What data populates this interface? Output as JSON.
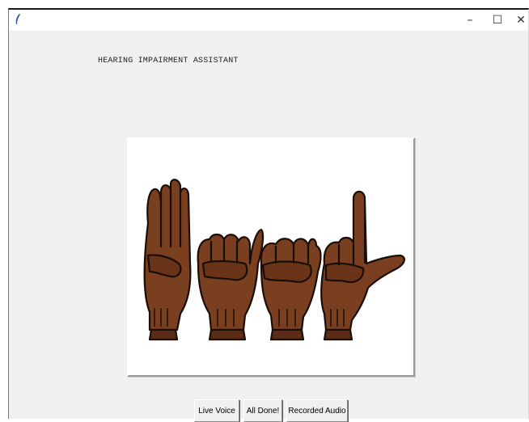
{
  "window": {
    "title": "",
    "controls": {
      "minimize": "–",
      "maximize": "☐",
      "close": "✕"
    },
    "app_icon": "feather-icon"
  },
  "main": {
    "heading": "HEARING IMPAIRMENT ASSISTANT",
    "image": {
      "description_icon": "sign-language-hands-icon"
    }
  },
  "buttons": {
    "live_voice": "Live Voice",
    "all_done": "All Done!",
    "recorded_audio": "Recorded Audio"
  },
  "colors": {
    "window_bg": "#f0f0f0",
    "skin": "#7a3f1e",
    "skin_dark": "#4a2412",
    "outline": "#1a0e08"
  }
}
